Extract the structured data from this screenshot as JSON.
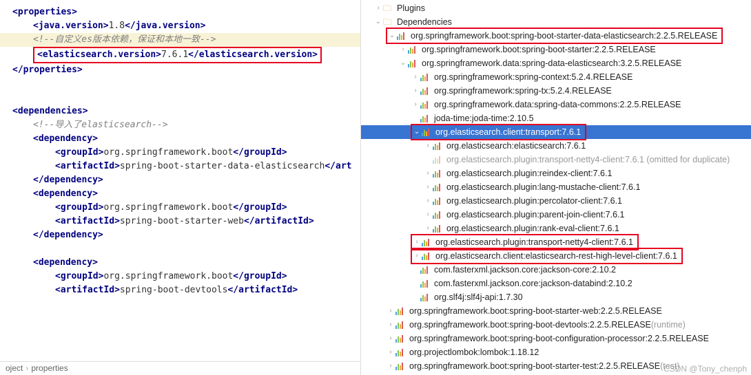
{
  "editor": {
    "properties_open": "<properties>",
    "java_open": "<java.version>",
    "java_val": "1.8",
    "java_close": "</java.version>",
    "comment1": "<!--自定义es版本依赖，保证和本地一致-->",
    "es_open": "<elasticsearch.version>",
    "es_val": "7.6.1",
    "es_close": "</elasticsearch.version>",
    "properties_close": "</properties>",
    "dependencies_open": "<dependencies>",
    "comment2": "<!--导入了elasticsearch-->",
    "dep_open": "<dependency>",
    "grp_open": "<groupId>",
    "grp1": "org.springframework.boot",
    "grp_close": "</groupId>",
    "art_open": "<artifactId>",
    "art1": "spring-boot-starter-data-elasticsearch",
    "art_close1": "</art",
    "art_close": "</artifactId>",
    "dep_close": "</dependency>",
    "art2": "spring-boot-starter-web",
    "art3": "spring-boot-devtools"
  },
  "breadcrumb": {
    "a": "oject",
    "b": "properties"
  },
  "tree": {
    "plugins": "Plugins",
    "deps": "Dependencies",
    "items": [
      {
        "d": 2,
        "arr": "v",
        "label": "org.springframework.boot:spring-boot-starter-data-elasticsearch:2.2.5.RELEASE",
        "red": true
      },
      {
        "d": 3,
        "arr": ">",
        "label": "org.springframework.boot:spring-boot-starter:2.2.5.RELEASE"
      },
      {
        "d": 3,
        "arr": "v",
        "label": "org.springframework.data:spring-data-elasticsearch:3.2.5.RELEASE"
      },
      {
        "d": 4,
        "arr": ">",
        "label": "org.springframework:spring-context:5.2.4.RELEASE"
      },
      {
        "d": 4,
        "arr": ">",
        "label": "org.springframework:spring-tx:5.2.4.RELEASE"
      },
      {
        "d": 4,
        "arr": ">",
        "label": "org.springframework.data:spring-data-commons:2.2.5.RELEASE"
      },
      {
        "d": 4,
        "arr": "",
        "label": "joda-time:joda-time:2.10.5"
      },
      {
        "d": 4,
        "arr": "v",
        "label": "org.elasticsearch.client:transport:7.6.1",
        "red": true,
        "sel": true
      },
      {
        "d": 5,
        "arr": ">",
        "label": "org.elasticsearch:elasticsearch:7.6.1"
      },
      {
        "d": 5,
        "arr": "",
        "label": "org.elasticsearch.plugin:transport-netty4-client:7.6.1 (omitted for duplicate)",
        "dim": true
      },
      {
        "d": 5,
        "arr": ">",
        "label": "org.elasticsearch.plugin:reindex-client:7.6.1"
      },
      {
        "d": 5,
        "arr": ">",
        "label": "org.elasticsearch.plugin:lang-mustache-client:7.6.1"
      },
      {
        "d": 5,
        "arr": ">",
        "label": "org.elasticsearch.plugin:percolator-client:7.6.1"
      },
      {
        "d": 5,
        "arr": ">",
        "label": "org.elasticsearch.plugin:parent-join-client:7.6.1"
      },
      {
        "d": 5,
        "arr": ">",
        "label": "org.elasticsearch.plugin:rank-eval-client:7.6.1"
      },
      {
        "d": 4,
        "arr": ">",
        "label": "org.elasticsearch.plugin:transport-netty4-client:7.6.1",
        "red": true
      },
      {
        "d": 4,
        "arr": ">",
        "label": "org.elasticsearch.client:elasticsearch-rest-high-level-client:7.6.1",
        "red": true
      },
      {
        "d": 4,
        "arr": "",
        "label": "com.fasterxml.jackson.core:jackson-core:2.10.2"
      },
      {
        "d": 4,
        "arr": "",
        "label": "com.fasterxml.jackson.core:jackson-databind:2.10.2"
      },
      {
        "d": 4,
        "arr": "",
        "label": "org.slf4j:slf4j-api:1.7.30"
      },
      {
        "d": 2,
        "arr": ">",
        "label": "org.springframework.boot:spring-boot-starter-web:2.2.5.RELEASE"
      },
      {
        "d": 2,
        "arr": ">",
        "label": "org.springframework.boot:spring-boot-devtools:2.2.5.RELEASE (runtime)",
        "dimtail": "(runtime)"
      },
      {
        "d": 2,
        "arr": ">",
        "label": "org.springframework.boot:spring-boot-configuration-processor:2.2.5.RELEASE"
      },
      {
        "d": 2,
        "arr": ">",
        "label": "org.projectlombok:lombok:1.18.12"
      },
      {
        "d": 2,
        "arr": ">",
        "label": "org.springframework.boot:spring-boot-starter-test:2.2.5.RELEASE (test)",
        "dimtail": "(test)"
      }
    ]
  },
  "watermark": "CSDN @Tony_chenph"
}
